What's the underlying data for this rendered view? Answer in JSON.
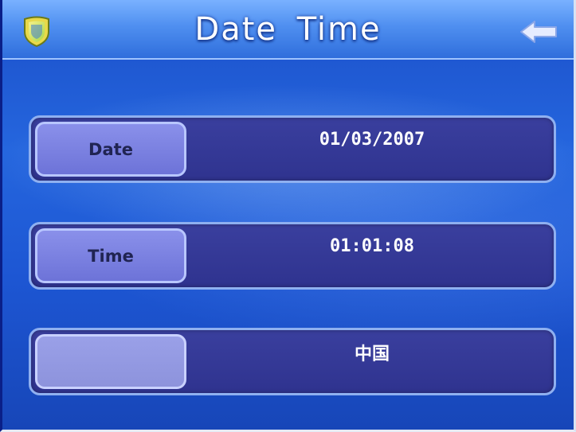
{
  "header": {
    "title": "Date Time",
    "logo_icon": "shield-icon",
    "back_icon": "back-arrow-icon"
  },
  "settings": [
    {
      "label": "Date",
      "value": "01/03/2007",
      "enabled": true
    },
    {
      "label": "Time",
      "value": "01:01:08",
      "enabled": true
    },
    {
      "label": "",
      "value": "中国",
      "enabled": false
    }
  ],
  "colors": {
    "background": "#2566de",
    "header": "#4f8ff0",
    "row_fill": "#33379a",
    "button_fill": "#7d83e2"
  }
}
